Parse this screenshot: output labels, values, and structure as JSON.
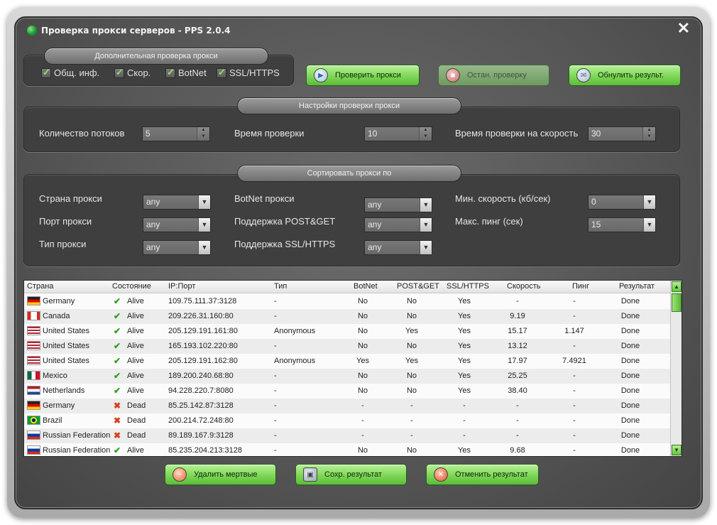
{
  "window": {
    "title": "Проверка прокси серверов - PPS 2.0.4"
  },
  "extra_check": {
    "title": "Дополнительная проверка прокси",
    "checkboxes": [
      "Общ. инф.",
      "Скор.",
      "BotNet",
      "SSL/HTTPS"
    ]
  },
  "actions": {
    "check": "Проверить прокси",
    "stop": "Остан. проверку",
    "reset": "Обнулить результ."
  },
  "settings": {
    "title": "Настройки проверки прокси",
    "threads_label": "Количество потоков",
    "threads_value": "5",
    "timeout_label": "Время проверки",
    "timeout_value": "10",
    "speed_timeout_label": "Время проверки на скорость",
    "speed_timeout_value": "30"
  },
  "sort": {
    "title": "Сортировать прокси по",
    "country_label": "Страна прокси",
    "country_value": "any",
    "port_label": "Порт прокси",
    "port_value": "any",
    "type_label": "Тип прокси",
    "type_value": "any",
    "botnet_label": "BotNet прокси",
    "botnet_value": "any",
    "postget_label": "Поддержка POST&GET",
    "postget_value": "any",
    "ssl_label": "Поддержка SSL/HTTPS",
    "ssl_value": "any",
    "min_speed_label": "Мин. скорость (кб/сек)",
    "min_speed_value": "0",
    "max_ping_label": "Макс. пинг (сек)",
    "max_ping_value": "15"
  },
  "table": {
    "headers": [
      "Страна",
      "Состояние",
      "IP:Порт",
      "Тип",
      "BotNet",
      "POST&GET",
      "SSL/HTTPS",
      "Скорость",
      "Пинг",
      "Результат"
    ],
    "rows": [
      {
        "flag": "de",
        "country": "Germany",
        "state": "Alive",
        "ok": true,
        "ip": "109.75.111.37:3128",
        "type": "-",
        "botnet": "No",
        "postget": "No",
        "ssl": "Yes",
        "speed": "-",
        "ping": "-",
        "result": "Done"
      },
      {
        "flag": "ca",
        "country": "Canada",
        "state": "Alive",
        "ok": true,
        "ip": "209.226.31.160:80",
        "type": "-",
        "botnet": "No",
        "postget": "No",
        "ssl": "Yes",
        "speed": "9.19",
        "ping": "-",
        "result": "Done"
      },
      {
        "flag": "us",
        "country": "United States",
        "state": "Alive",
        "ok": true,
        "ip": "205.129.191.161:80",
        "type": "Anonymous",
        "botnet": "No",
        "postget": "Yes",
        "ssl": "Yes",
        "speed": "15.17",
        "ping": "1.147",
        "result": "Done"
      },
      {
        "flag": "us",
        "country": "United States",
        "state": "Alive",
        "ok": true,
        "ip": "165.193.102.220:80",
        "type": "-",
        "botnet": "No",
        "postget": "No",
        "ssl": "Yes",
        "speed": "13.12",
        "ping": "-",
        "result": "Done"
      },
      {
        "flag": "us",
        "country": "United States",
        "state": "Alive",
        "ok": true,
        "ip": "205.129.191.162:80",
        "type": "Anonymous",
        "botnet": "Yes",
        "postget": "Yes",
        "ssl": "Yes",
        "speed": "17.97",
        "ping": "7.4921",
        "result": "Done"
      },
      {
        "flag": "mx",
        "country": "Mexico",
        "state": "Alive",
        "ok": true,
        "ip": "189.200.240.68:80",
        "type": "-",
        "botnet": "No",
        "postget": "No",
        "ssl": "Yes",
        "speed": "25.25",
        "ping": "-",
        "result": "Done"
      },
      {
        "flag": "nl",
        "country": "Netherlands",
        "state": "Alive",
        "ok": true,
        "ip": "94.228.220.7:8080",
        "type": "-",
        "botnet": "No",
        "postget": "No",
        "ssl": "Yes",
        "speed": "38.40",
        "ping": "-",
        "result": "Done"
      },
      {
        "flag": "de",
        "country": "Germany",
        "state": "Dead",
        "ok": false,
        "ip": "85.25.142.87:3128",
        "type": "-",
        "botnet": "-",
        "postget": "-",
        "ssl": "-",
        "speed": "-",
        "ping": "-",
        "result": "Done"
      },
      {
        "flag": "br",
        "country": "Brazil",
        "state": "Dead",
        "ok": false,
        "ip": "200.214.72.248:80",
        "type": "-",
        "botnet": "-",
        "postget": "-",
        "ssl": "-",
        "speed": "-",
        "ping": "-",
        "result": "Done"
      },
      {
        "flag": "ru",
        "country": "Russian Federation",
        "state": "Dead",
        "ok": false,
        "ip": "89.189.167.9:3128",
        "type": "-",
        "botnet": "-",
        "postget": "-",
        "ssl": "-",
        "speed": "-",
        "ping": "-",
        "result": "Done"
      },
      {
        "flag": "ru",
        "country": "Russian Federation",
        "state": "Alive",
        "ok": true,
        "ip": "85.235.204.213:3128",
        "type": "-",
        "botnet": "No",
        "postget": "No",
        "ssl": "Yes",
        "speed": "9.68",
        "ping": "-",
        "result": "Done"
      }
    ]
  },
  "bottom": {
    "delete_dead": "Удалить мертвые",
    "save": "Сохр. результат",
    "cancel": "Отменить результат"
  }
}
